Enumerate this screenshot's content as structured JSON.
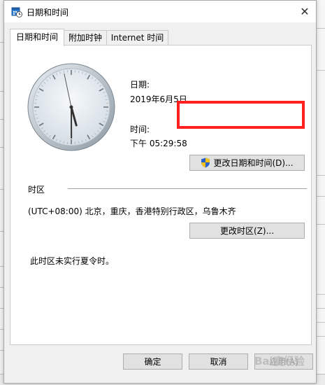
{
  "window": {
    "title": "日期和时间",
    "close_glyph": "✕"
  },
  "tabs": [
    {
      "label": "日期和时间",
      "active": true
    },
    {
      "label": "附加时钟",
      "active": false
    },
    {
      "label": "Internet 时间",
      "active": false
    }
  ],
  "date_section": {
    "date_label": "日期:",
    "date_value": "2019年6月5日",
    "time_label": "时间:",
    "time_value": "下午 05:29:58",
    "change_button": "更改日期和时间(D)..."
  },
  "clock": {
    "hour": 5,
    "minute": 29,
    "second": 58
  },
  "timezone_section": {
    "header": "时区",
    "value": "(UTC+08:00) 北京，重庆，香港特别行政区，乌鲁木齐",
    "change_button": "更改时区(Z)...",
    "dst_note": "此时区未实行夏令时。"
  },
  "footer": {
    "ok": "确定",
    "cancel": "取消",
    "apply": "应用(A)"
  },
  "watermark": "Bai度经验",
  "colors": {
    "highlight": "#ff2020",
    "dialog_bg": "#f0f0f0",
    "button_bg": "#e1e1e1"
  }
}
